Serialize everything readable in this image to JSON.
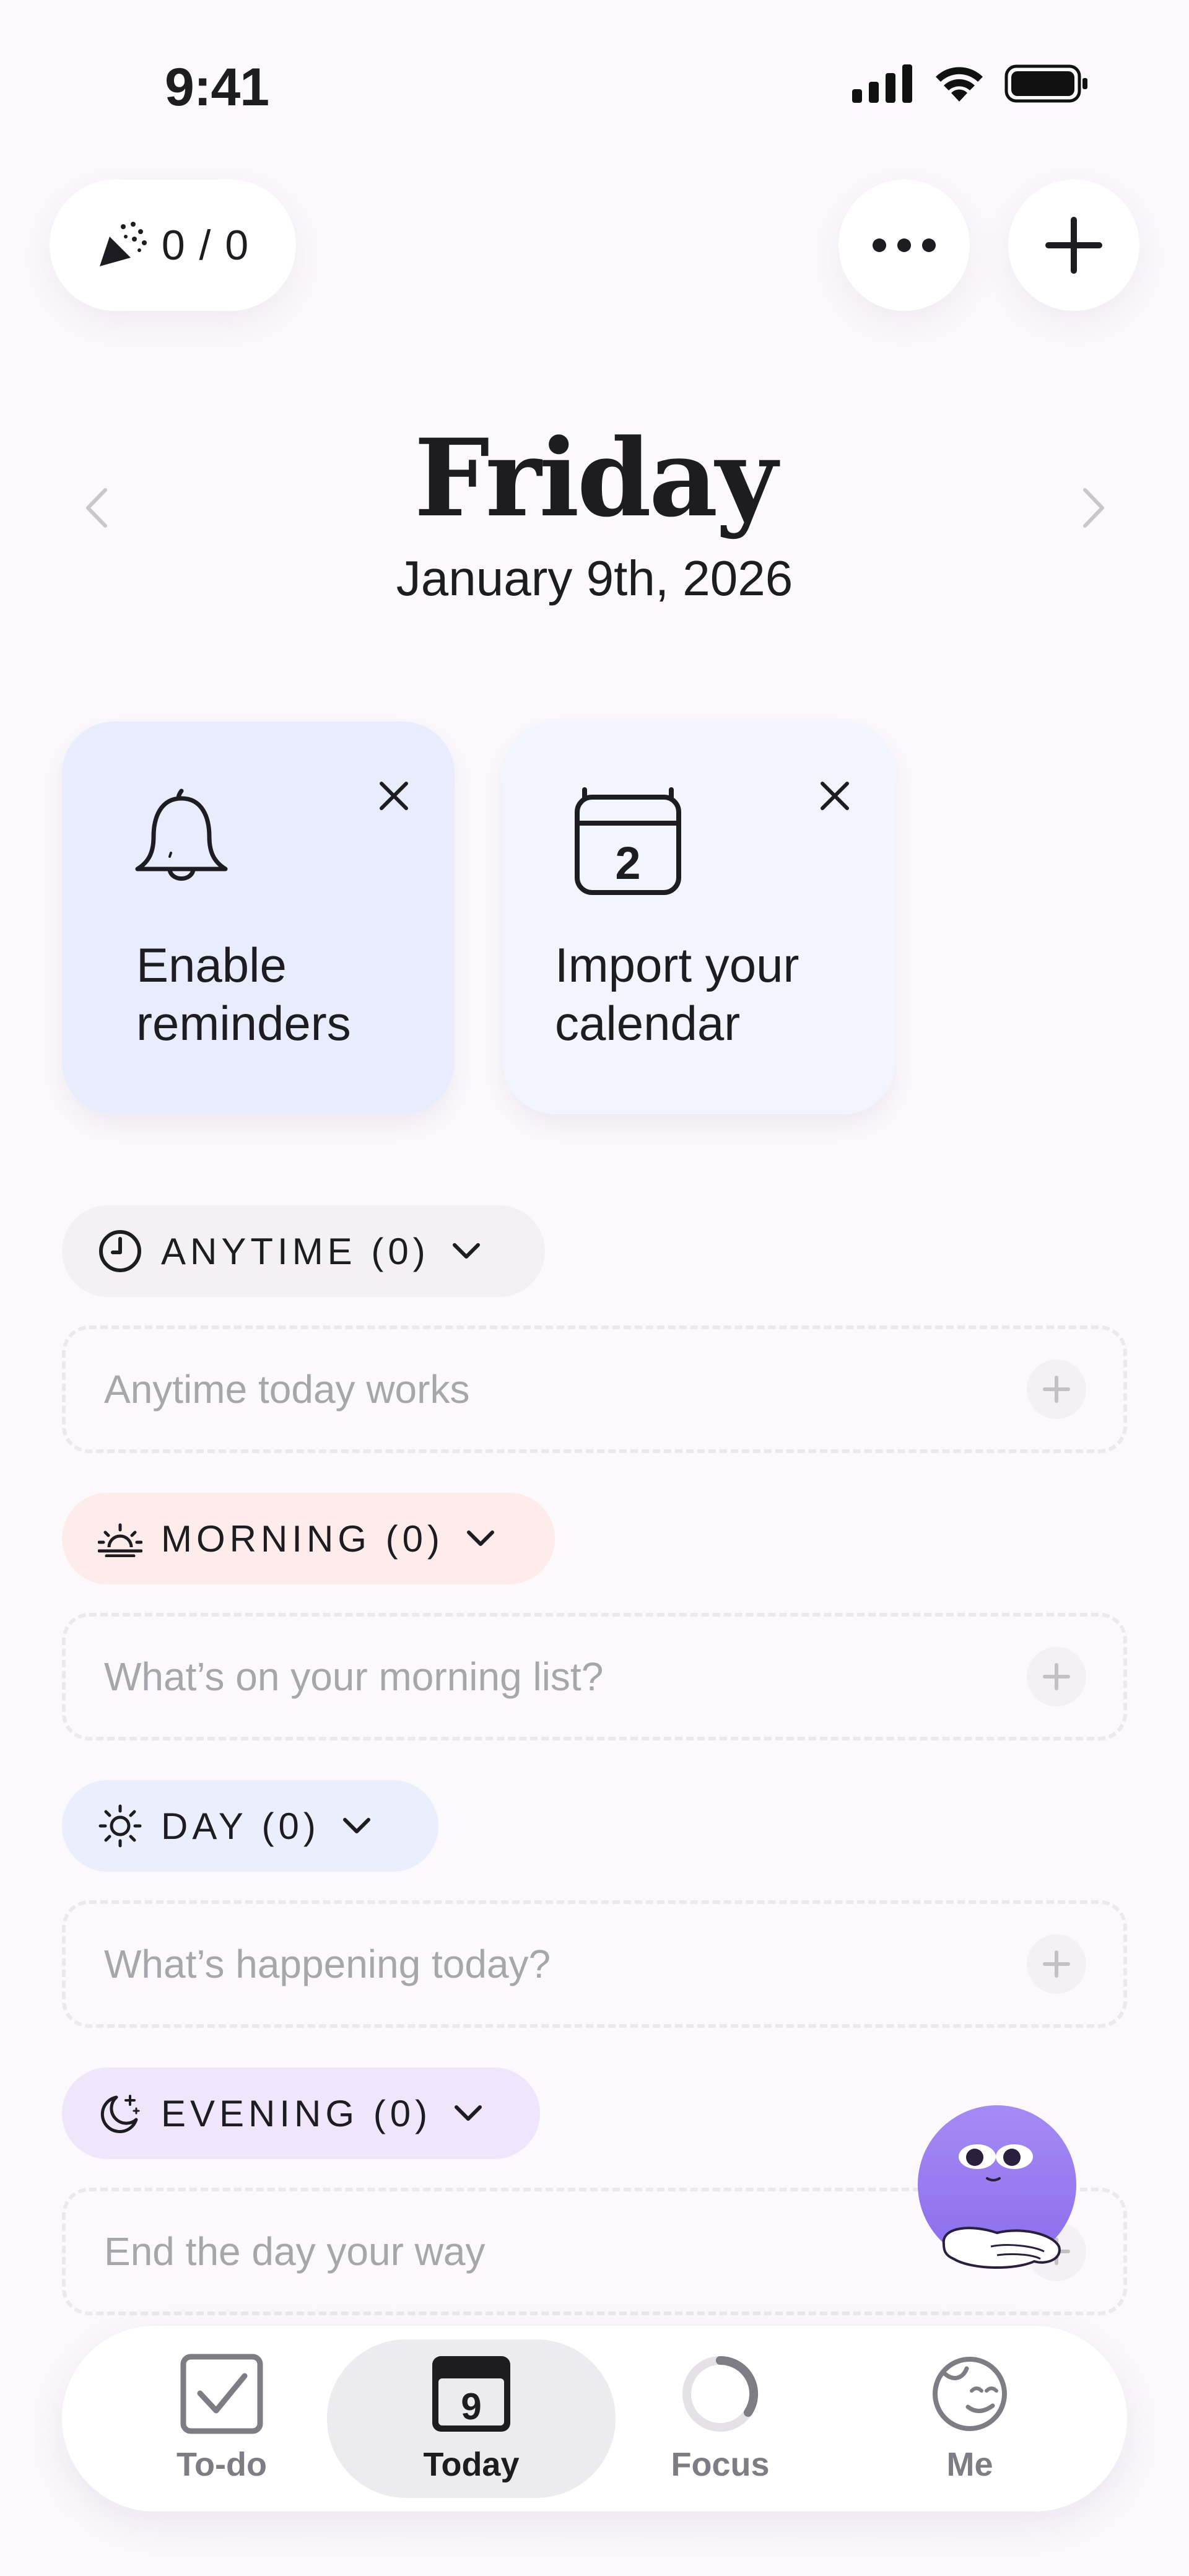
{
  "status_bar": {
    "time": "9:41"
  },
  "header": {
    "streak": "0 / 0",
    "more_icon": "ellipsis-icon",
    "add_icon": "plus-icon"
  },
  "date": {
    "weekday": "Friday",
    "full_date": "January 9th, 2026"
  },
  "cards": [
    {
      "label": "Enable reminders",
      "icon": "bell-icon",
      "bg": "#e9ecfc"
    },
    {
      "label": "Import your calendar",
      "icon": "calendar-icon",
      "day": "2",
      "bg": "#f2f5fe"
    }
  ],
  "sections": [
    {
      "label": "ANYTIME (0)",
      "placeholder": "Anytime today works",
      "icon": "clock-icon",
      "bg": "#f3f1f3"
    },
    {
      "label": "MORNING (0)",
      "placeholder": "What’s on your morning list?",
      "icon": "sunrise-icon",
      "bg": "#fdecea"
    },
    {
      "label": "DAY (0)",
      "placeholder": "What’s happening today?",
      "icon": "sun-icon",
      "bg": "#ebeefd"
    },
    {
      "label": "EVENING (0)",
      "placeholder": "End the day your way",
      "icon": "moon-stars-icon",
      "bg": "#efe6fc"
    }
  ],
  "tabbar": {
    "tabs": [
      {
        "label": "To-do",
        "icon": "checkbox-icon"
      },
      {
        "label": "Today",
        "icon": "calendar-day-icon",
        "day": "9"
      },
      {
        "label": "Focus",
        "icon": "progress-ring-icon"
      },
      {
        "label": "Me",
        "icon": "face-icon"
      }
    ],
    "active": "Today"
  },
  "colors": {
    "background": "#fcf9fd",
    "text": "#1d1d21",
    "placeholder": "#a8a6ad",
    "mascot": "#9b7ff0"
  }
}
